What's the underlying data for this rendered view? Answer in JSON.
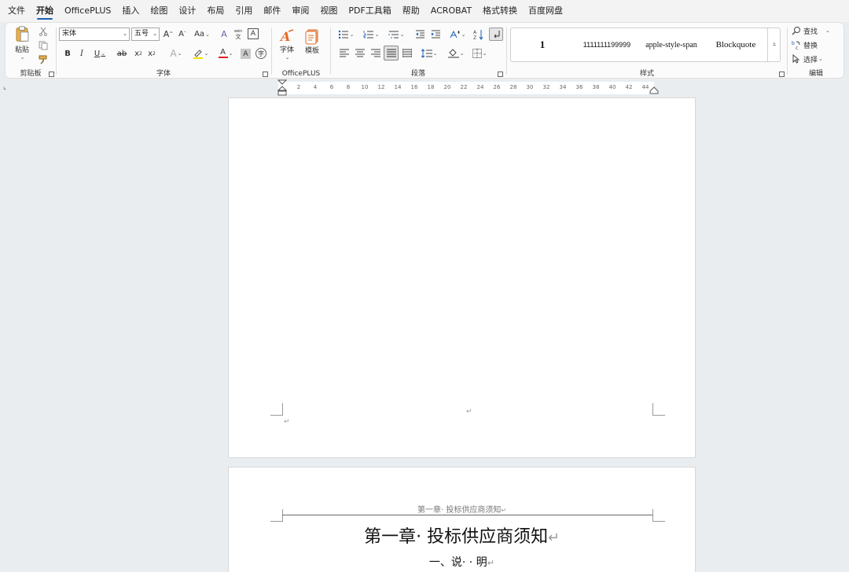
{
  "menu": {
    "items": [
      "文件",
      "开始",
      "OfficePLUS",
      "插入",
      "绘图",
      "设计",
      "布局",
      "引用",
      "邮件",
      "审阅",
      "视图",
      "PDF工具箱",
      "帮助",
      "ACROBAT",
      "格式转换",
      "百度网盘"
    ],
    "active_index": 1
  },
  "ribbon": {
    "clipboard": {
      "label": "剪贴板",
      "paste_label": "粘贴"
    },
    "font": {
      "label": "字体",
      "font_name": "宋体",
      "font_size": "五号",
      "change_case": "Aa",
      "phonetic": "wén"
    },
    "officeplus": {
      "label": "OfficePLUS",
      "font_button": "字体",
      "template_button": "模板"
    },
    "paragraph": {
      "label": "段落"
    },
    "styles": {
      "label": "样式",
      "items": [
        "1",
        "1111111199999",
        "apple-style-span",
        "Blockquote"
      ]
    },
    "editing": {
      "label": "编辑",
      "find": "查找",
      "replace": "替换",
      "select": "选择"
    }
  },
  "ruler": {
    "numbers": [
      "2",
      "4",
      "6",
      "8",
      "10",
      "12",
      "14",
      "16",
      "18",
      "20",
      "22",
      "24",
      "26",
      "28",
      "30",
      "32",
      "34",
      "36",
      "38",
      "40",
      "42",
      "44"
    ]
  },
  "document": {
    "para_mark": "↵",
    "page2": {
      "header": "第一章· 投标供应商须知",
      "chapter_title": "第一章· 投标供应商须知",
      "section_title": "一、说· · 明"
    }
  }
}
